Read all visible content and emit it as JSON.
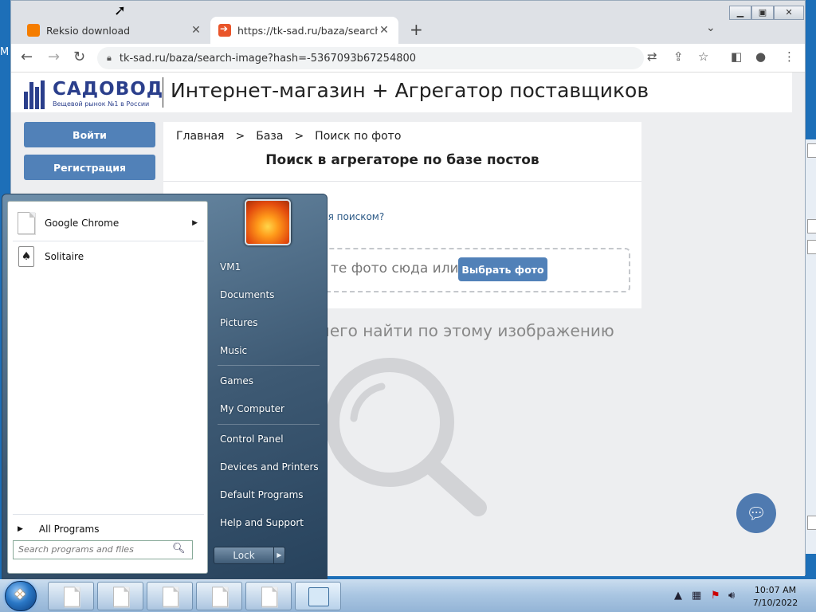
{
  "desktop": {
    "edge_text": "M"
  },
  "browser": {
    "tabs": [
      {
        "title": "Reksio download",
        "favicon": "blogger-icon"
      },
      {
        "title": "https://tk-sad.ru/baza/search-im",
        "favicon": "arrow-favicon-icon"
      }
    ],
    "address": "tk-sad.ru/baza/search-image?hash=-5367093b67254800"
  },
  "site": {
    "logo_name": "САДОВОД",
    "logo_tagline": "Вещевой рынок №1 в России",
    "headline": "Интернет-магазин  +  Агрегатор поставщиков",
    "login_label": "Войти",
    "register_label": "Регистрация",
    "breadcrumb": [
      "Главная",
      ">",
      "База",
      ">",
      "Поиск по фото"
    ],
    "title": "Поиск в агрегаторе по базе постов",
    "hint_text": "ся поиском?",
    "drop_text": "те фото сюда или",
    "pick_label": "Выбрать фото",
    "nothing_found": "чего найти по этому изображению"
  },
  "startmenu": {
    "pinned": [
      {
        "label": "Google Chrome",
        "has_submenu": true
      },
      {
        "label": "Solitaire",
        "has_submenu": false
      }
    ],
    "all_programs": "All Programs",
    "search_placeholder": "Search programs and files",
    "right_items": [
      "VM1",
      "Documents",
      "Pictures",
      "Music",
      "Games",
      "My Computer",
      "Control Panel",
      "Devices and Printers",
      "Default Programs",
      "Help and Support"
    ],
    "lock_label": "Lock"
  },
  "taskbar": {
    "time": "10:07 AM",
    "date": "7/10/2022"
  },
  "colors": {
    "accent": "#5181b8",
    "logo": "#2b3f8c"
  }
}
